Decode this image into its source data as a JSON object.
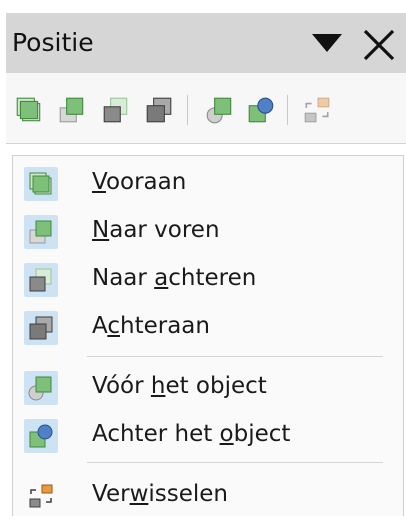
{
  "panel": {
    "title": "Positie",
    "dropdown_icon": "triangle-down-icon",
    "close_icon": "close-icon"
  },
  "toolbar": {
    "buttons": [
      {
        "icon": "bring-to-front-icon"
      },
      {
        "icon": "bring-forward-icon"
      },
      {
        "icon": "send-backward-icon"
      },
      {
        "icon": "send-to-back-icon"
      },
      {
        "icon": "in-front-of-object-icon"
      },
      {
        "icon": "behind-object-icon"
      },
      {
        "icon": "reverse-icon"
      }
    ]
  },
  "menu": {
    "items": [
      {
        "pre": "",
        "mnemonic": "V",
        "post": "ooraan",
        "icon": "bring-to-front-icon"
      },
      {
        "pre": "",
        "mnemonic": "N",
        "post": "aar voren",
        "icon": "bring-forward-icon"
      },
      {
        "pre": "Naar ",
        "mnemonic": "a",
        "post": "chteren",
        "icon": "send-backward-icon"
      },
      {
        "pre": "A",
        "mnemonic": "c",
        "post": "hteraan",
        "icon": "send-to-back-icon"
      },
      {
        "pre": "Vóór ",
        "mnemonic": "h",
        "post": "et object",
        "icon": "in-front-of-object-icon"
      },
      {
        "pre": "Achter het ",
        "mnemonic": "o",
        "post": "bject",
        "icon": "behind-object-icon"
      },
      {
        "pre": "Ver",
        "mnemonic": "w",
        "post": "isselen",
        "icon": "reverse-icon"
      }
    ]
  },
  "colors": {
    "green_fill": "#7ec07a",
    "green_dark": "#3f8a3c",
    "gray_fill": "#8a8a8a",
    "gray_dark": "#3e3e3e",
    "blue_fill": "#4f80c8",
    "orange_fill": "#e89a3c",
    "highlight": "#cde3f3",
    "titlebar": "#d6d6d6"
  }
}
